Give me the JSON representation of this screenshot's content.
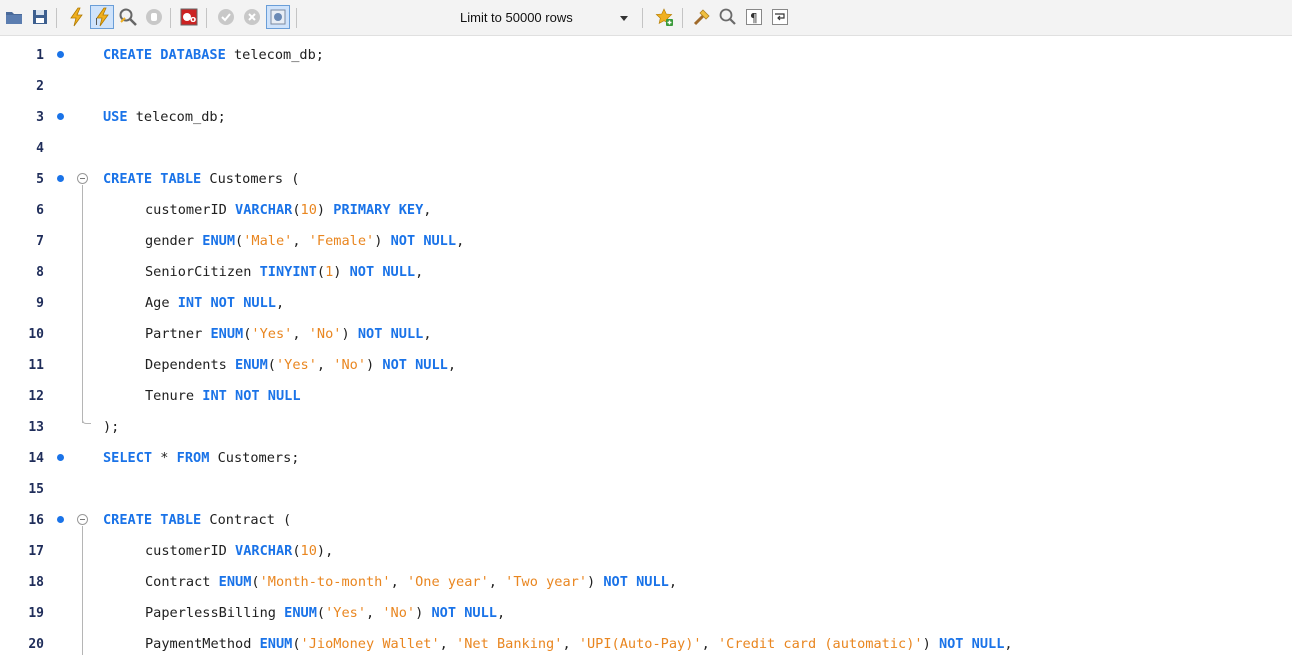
{
  "toolbar": {
    "limit_label": "Limit to 50000 rows",
    "icons": [
      "open-folder-icon",
      "save-icon",
      "execute-icon",
      "execute-current-icon",
      "explain-icon",
      "stop-icon",
      "toggle-error-icon",
      "commit-icon",
      "rollback-icon",
      "autocommit-icon",
      "add-snippet-icon",
      "beautify-icon",
      "find-icon",
      "invisible-chars-icon",
      "wrap-lines-icon"
    ]
  },
  "colors": {
    "keyword": "#1a73e8",
    "string": "#e98620",
    "number": "#e98620",
    "linenum": "#1f2d5a",
    "dot": "#1a73e8"
  },
  "lines": [
    {
      "n": "1",
      "t": [
        [
          "kw",
          "CREATE DATABASE"
        ],
        [
          "pl",
          " telecom_db;"
        ]
      ]
    },
    {
      "n": "2",
      "t": []
    },
    {
      "n": "3",
      "t": [
        [
          "kw",
          "USE"
        ],
        [
          "pl",
          " telecom_db;"
        ]
      ]
    },
    {
      "n": "4",
      "t": []
    },
    {
      "n": "5",
      "t": [
        [
          "kw",
          "CREATE TABLE"
        ],
        [
          "pl",
          " Customers ("
        ]
      ]
    },
    {
      "n": "6",
      "t": [
        [
          "pl",
          "customerID "
        ],
        [
          "kw",
          "VARCHAR"
        ],
        [
          "pl",
          "("
        ],
        [
          "nm",
          "10"
        ],
        [
          "pl",
          ") "
        ],
        [
          "kw",
          "PRIMARY KEY"
        ],
        [
          "pl",
          ","
        ]
      ]
    },
    {
      "n": "7",
      "t": [
        [
          "pl",
          "gender "
        ],
        [
          "kw",
          "ENUM"
        ],
        [
          "pl",
          "("
        ],
        [
          "st",
          "'Male'"
        ],
        [
          "pl",
          ", "
        ],
        [
          "st",
          "'Female'"
        ],
        [
          "pl",
          ") "
        ],
        [
          "kw",
          "NOT NULL"
        ],
        [
          "pl",
          ","
        ]
      ]
    },
    {
      "n": "8",
      "t": [
        [
          "pl",
          "SeniorCitizen "
        ],
        [
          "kw",
          "TINYINT"
        ],
        [
          "pl",
          "("
        ],
        [
          "nm",
          "1"
        ],
        [
          "pl",
          ") "
        ],
        [
          "kw",
          "NOT NULL"
        ],
        [
          "pl",
          ","
        ]
      ]
    },
    {
      "n": "9",
      "t": [
        [
          "pl",
          "Age "
        ],
        [
          "kw",
          "INT NOT NULL"
        ],
        [
          "pl",
          ","
        ]
      ]
    },
    {
      "n": "10",
      "t": [
        [
          "pl",
          "Partner "
        ],
        [
          "kw",
          "ENUM"
        ],
        [
          "pl",
          "("
        ],
        [
          "st",
          "'Yes'"
        ],
        [
          "pl",
          ", "
        ],
        [
          "st",
          "'No'"
        ],
        [
          "pl",
          ") "
        ],
        [
          "kw",
          "NOT NULL"
        ],
        [
          "pl",
          ","
        ]
      ]
    },
    {
      "n": "11",
      "t": [
        [
          "pl",
          "Dependents "
        ],
        [
          "kw",
          "ENUM"
        ],
        [
          "pl",
          "("
        ],
        [
          "st",
          "'Yes'"
        ],
        [
          "pl",
          ", "
        ],
        [
          "st",
          "'No'"
        ],
        [
          "pl",
          ") "
        ],
        [
          "kw",
          "NOT NULL"
        ],
        [
          "pl",
          ","
        ]
      ]
    },
    {
      "n": "12",
      "t": [
        [
          "pl",
          "Tenure "
        ],
        [
          "kw",
          "INT NOT NULL"
        ]
      ]
    },
    {
      "n": "13",
      "t": [
        [
          "pl",
          ");"
        ]
      ]
    },
    {
      "n": "14",
      "t": [
        [
          "kw",
          "SELECT"
        ],
        [
          "pl",
          " * "
        ],
        [
          "kw",
          "FROM"
        ],
        [
          "pl",
          " Customers;"
        ]
      ]
    },
    {
      "n": "15",
      "t": []
    },
    {
      "n": "16",
      "t": [
        [
          "kw",
          "CREATE TABLE"
        ],
        [
          "pl",
          " Contract ("
        ]
      ]
    },
    {
      "n": "17",
      "t": [
        [
          "pl",
          "customerID "
        ],
        [
          "kw",
          "VARCHAR"
        ],
        [
          "pl",
          "("
        ],
        [
          "nm",
          "10"
        ],
        [
          "pl",
          "),"
        ]
      ]
    },
    {
      "n": "18",
      "t": [
        [
          "pl",
          "Contract "
        ],
        [
          "kw",
          "ENUM"
        ],
        [
          "pl",
          "("
        ],
        [
          "st",
          "'Month-to-month'"
        ],
        [
          "pl",
          ", "
        ],
        [
          "st",
          "'One year'"
        ],
        [
          "pl",
          ", "
        ],
        [
          "st",
          "'Two year'"
        ],
        [
          "pl",
          ") "
        ],
        [
          "kw",
          "NOT NULL"
        ],
        [
          "pl",
          ","
        ]
      ]
    },
    {
      "n": "19",
      "t": [
        [
          "pl",
          "PaperlessBilling "
        ],
        [
          "kw",
          "ENUM"
        ],
        [
          "pl",
          "("
        ],
        [
          "st",
          "'Yes'"
        ],
        [
          "pl",
          ", "
        ],
        [
          "st",
          "'No'"
        ],
        [
          "pl",
          ") "
        ],
        [
          "kw",
          "NOT NULL"
        ],
        [
          "pl",
          ","
        ]
      ]
    },
    {
      "n": "20",
      "t": [
        [
          "pl",
          "PaymentMethod "
        ],
        [
          "kw",
          "ENUM"
        ],
        [
          "pl",
          "("
        ],
        [
          "st",
          "'JioMoney Wallet'"
        ],
        [
          "pl",
          ", "
        ],
        [
          "st",
          "'Net Banking'"
        ],
        [
          "pl",
          ", "
        ],
        [
          "st",
          "'UPI(Auto-Pay)'"
        ],
        [
          "pl",
          ", "
        ],
        [
          "st",
          "'Credit card (automatic)'"
        ],
        [
          "pl",
          ") "
        ],
        [
          "kw",
          "NOT NULL"
        ],
        [
          "pl",
          ","
        ]
      ]
    }
  ]
}
